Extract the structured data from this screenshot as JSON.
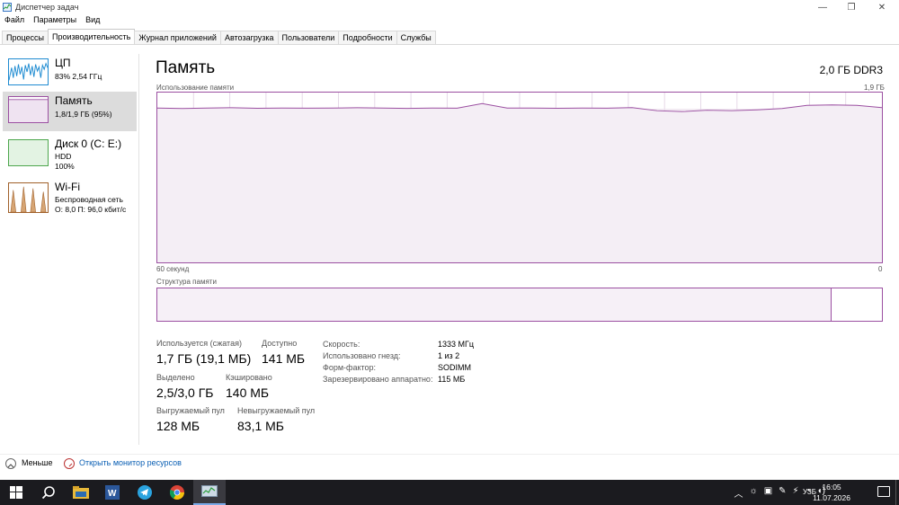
{
  "window": {
    "title": "Диспетчер задач",
    "controls": {
      "minimize": "—",
      "maximize": "❐",
      "close": "✕"
    }
  },
  "menu": [
    "Файл",
    "Параметры",
    "Вид"
  ],
  "tabs": [
    {
      "label": "Процессы",
      "active": false
    },
    {
      "label": "Производительность",
      "active": true
    },
    {
      "label": "Журнал приложений",
      "active": false
    },
    {
      "label": "Автозагрузка",
      "active": false
    },
    {
      "label": "Пользователи",
      "active": false
    },
    {
      "label": "Подробности",
      "active": false
    },
    {
      "label": "Службы",
      "active": false
    }
  ],
  "sidebar": {
    "cpu": {
      "title": "ЦП",
      "sub": "83% 2,54 ГГц",
      "color": "#1e8bd1"
    },
    "memory": {
      "title": "Память",
      "sub": "1,8/1,9 ГБ (95%)",
      "color": "#9b4fa1"
    },
    "disk": {
      "title": "Диск 0 (C: E:)",
      "sub1": "HDD",
      "sub2": "100%",
      "color": "#4da64d"
    },
    "wifi": {
      "title": "Wi-Fi",
      "sub1": "Беспроводная сеть",
      "sub2": "О: 8,0 П: 96,0 кбит/с",
      "color": "#a0602a"
    }
  },
  "main": {
    "title": "Память",
    "mem_type": "2,0 ГБ DDR3",
    "usage_label": "Использование памяти",
    "usage_max": "1,9 ГБ",
    "time_left": "60 секунд",
    "time_right": "0",
    "composition_label": "Структура памяти",
    "usage_level_fraction": 0.93
  },
  "stats": {
    "in_use_label": "Используется (сжатая)",
    "in_use_value": "1,7 ГБ (19,1 МБ)",
    "available_label": "Доступно",
    "available_value": "141 МБ",
    "committed_label": "Выделено",
    "committed_value": "2,5/3,0 ГБ",
    "cached_label": "Кэшировано",
    "cached_value": "140 МБ",
    "paged_label": "Выгружаемый пул",
    "paged_value": "128 МБ",
    "nonpaged_label": "Невыгружаемый пул",
    "nonpaged_value": "83,1 МБ"
  },
  "specs": [
    {
      "label": "Скорость:",
      "value": "1333 МГц"
    },
    {
      "label": "Использовано гнезд:",
      "value": "1 из 2"
    },
    {
      "label": "Форм-фактор:",
      "value": "SODIMM"
    },
    {
      "label": "Зарезервировано аппаратно:",
      "value": "115 МБ"
    }
  ],
  "footer": {
    "fewer": "Меньше",
    "monitor": "Открыть монитор ресурсов"
  },
  "taskbar": {
    "lang": "УЗБ",
    "time": "16:05",
    "date": "11.07.2026"
  }
}
